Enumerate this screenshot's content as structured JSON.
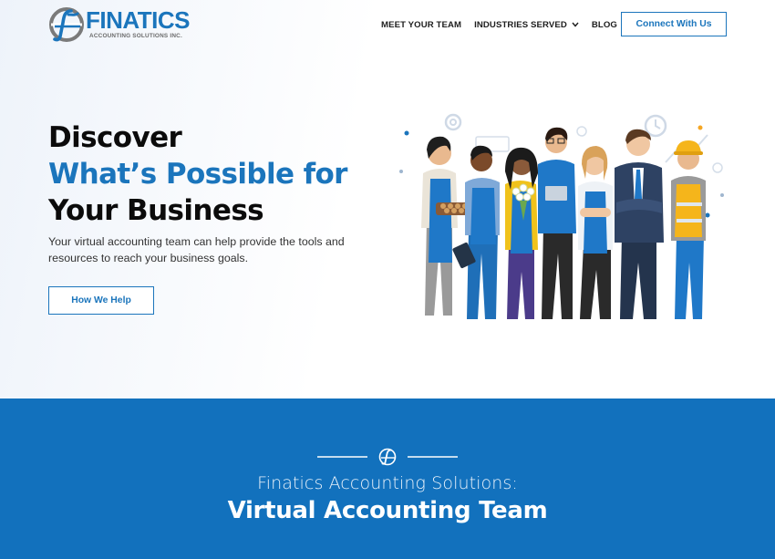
{
  "header": {
    "logo": {
      "name": "FINATICS",
      "tagline": "ACCOUNTING SOLUTIONS INC."
    },
    "nav": [
      {
        "label": "MEET YOUR TEAM"
      },
      {
        "label": "INDUSTRIES SERVED",
        "has_dropdown": true
      },
      {
        "label": "BLOG"
      }
    ],
    "cta_label": "Connect With Us"
  },
  "hero": {
    "title_line1": "Discover",
    "title_line2": "What’s Possible for",
    "title_line3": "Your Business",
    "description": "Your virtual accounting team can help provide the tools and resources to reach your business goals.",
    "button_label": "How We Help",
    "illustration": "team-of-professionals-illustration"
  },
  "band": {
    "subtitle": "Finatics Accounting Solutions:",
    "title": "Virtual Accounting Team",
    "divider_icon": "finatics-logo-icon"
  },
  "colors": {
    "brand_blue": "#1b75bc",
    "band_blue": "#1271bd",
    "heading_dark": "#0b0b0b",
    "logo_gray": "#7a7a7a"
  }
}
